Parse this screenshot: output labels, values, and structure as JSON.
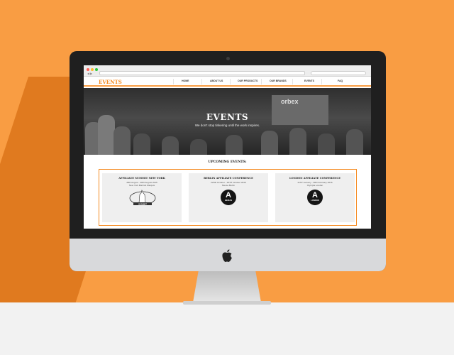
{
  "site": {
    "logo": "EVENTS",
    "nav": [
      "HOME",
      "ABOUT US",
      "OUR PRODUCTS",
      "OUR BRANDS",
      "EVENTS",
      "FAQ"
    ]
  },
  "hero": {
    "title": "EVENTS",
    "subtitle": "We don't stop tinkering until the work inspires.",
    "booth_sign": "orbex"
  },
  "upcoming": {
    "title": "UPCOMING EVENTS:",
    "events": [
      {
        "name": "AFFILIATE SUMMIT NEW YORK",
        "dates": "3RD August - 4RD August 2015",
        "venue": "New York Marriott Marquis",
        "logo_icon": "affiliate-summit-logo",
        "logo_text": "SUMMIT"
      },
      {
        "name": "BERLIN AFFILIATE CONFERENCE",
        "dates": "22ND October - 25TH October 2015",
        "venue": "Messe Berlin",
        "logo_icon": "berlin-conference-logo",
        "logo_letter": "A",
        "logo_city": "BERLIN"
      },
      {
        "name": "LONDON AFFILIATE CONFERENCE",
        "dates": "21ST January - 3RD February 2016",
        "venue": "Olympia London",
        "logo_icon": "london-conference-logo",
        "logo_letter": "A",
        "logo_city": "LONDON"
      }
    ]
  },
  "colors": {
    "background": "#f99d43",
    "accent": "#f58a1f",
    "bezel": "#1f1f1f"
  }
}
